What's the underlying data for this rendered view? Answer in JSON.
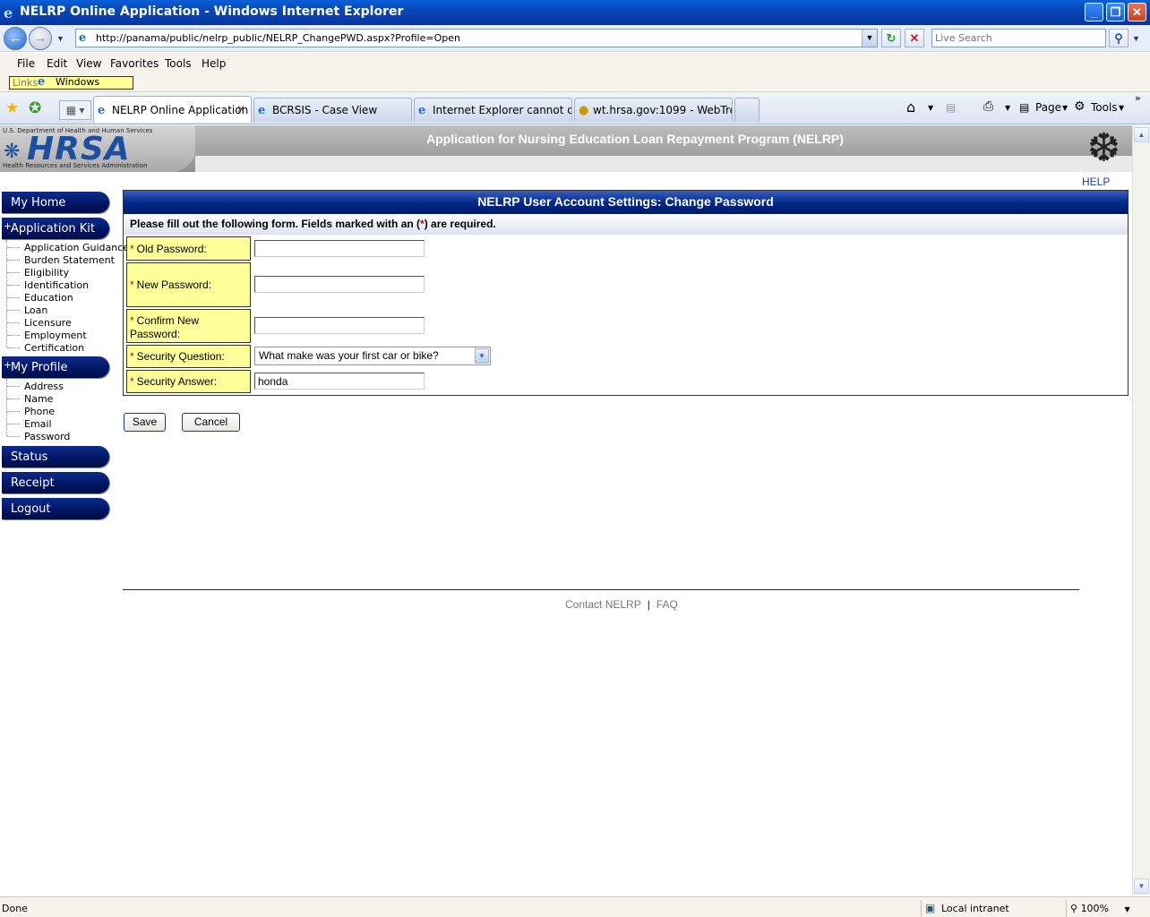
{
  "window": {
    "title": "NELRP Online Application - Windows Internet Explorer",
    "buttons": {
      "minimize": "_",
      "maximize": "❐",
      "close": "✕"
    }
  },
  "addressbar": {
    "url": "http://panama/public/nelrp_public/NELRP_ChangePWD.aspx?Profile=Open",
    "search_placeholder": "Live Search"
  },
  "menu": {
    "items": [
      "File",
      "Edit",
      "View",
      "Favorites",
      "Tools",
      "Help"
    ]
  },
  "links": {
    "label": "Links",
    "windows": "Windows"
  },
  "tabs": [
    {
      "label": "NELRP Online Application",
      "active": true
    },
    {
      "label": "BCRSIS - Case View"
    },
    {
      "label": "Internet Explorer cannot dis..."
    },
    {
      "label": "wt.hrsa.gov:1099 - WebTre..."
    }
  ],
  "commandbar": {
    "page": "Page",
    "tools": "Tools"
  },
  "banner": {
    "dept": "U.S. Department of Health and Human Services",
    "logo": "HRSA",
    "agency": "Health Resources and Services Administration",
    "app_title": "Application for Nursing Education Loan Repayment Program (NELRP)"
  },
  "help_link": "HELP",
  "sidebar": {
    "my_home": "My Home",
    "application_kit": "Application Kit",
    "application_items": [
      "Application Guidance",
      "Burden Statement",
      "Eligibility",
      "Identification",
      "Education",
      "Loan",
      "Licensure",
      "Employment",
      "Certification"
    ],
    "my_profile": "My Profile",
    "profile_items": [
      "Address",
      "Name",
      "Phone",
      "Email",
      "Password"
    ],
    "status": "Status",
    "receipt": "Receipt",
    "logout": "Logout",
    "plus": "+"
  },
  "form": {
    "title": "NELRP User Account Settings: Change Password",
    "instruction_pre": "Please fill out the following form. Fields marked with an (",
    "instruction_req": "*",
    "instruction_post": ") are required.",
    "asterisk": "*",
    "old_password_label": "Old Password:",
    "new_password_label": "New Password:",
    "confirm_password_label": "Confirm New Password:",
    "security_question_label": "Security Question:",
    "security_question_value": "What make was your first car or bike?",
    "security_answer_label": "Security Answer:",
    "security_answer_value": "honda",
    "save": "Save",
    "cancel": "Cancel"
  },
  "footer": {
    "contact": "Contact NELRP",
    "sep": "|",
    "faq": "FAQ"
  },
  "statusbar": {
    "status": "Done",
    "zone": "Local intranet",
    "zoom": "100%"
  }
}
